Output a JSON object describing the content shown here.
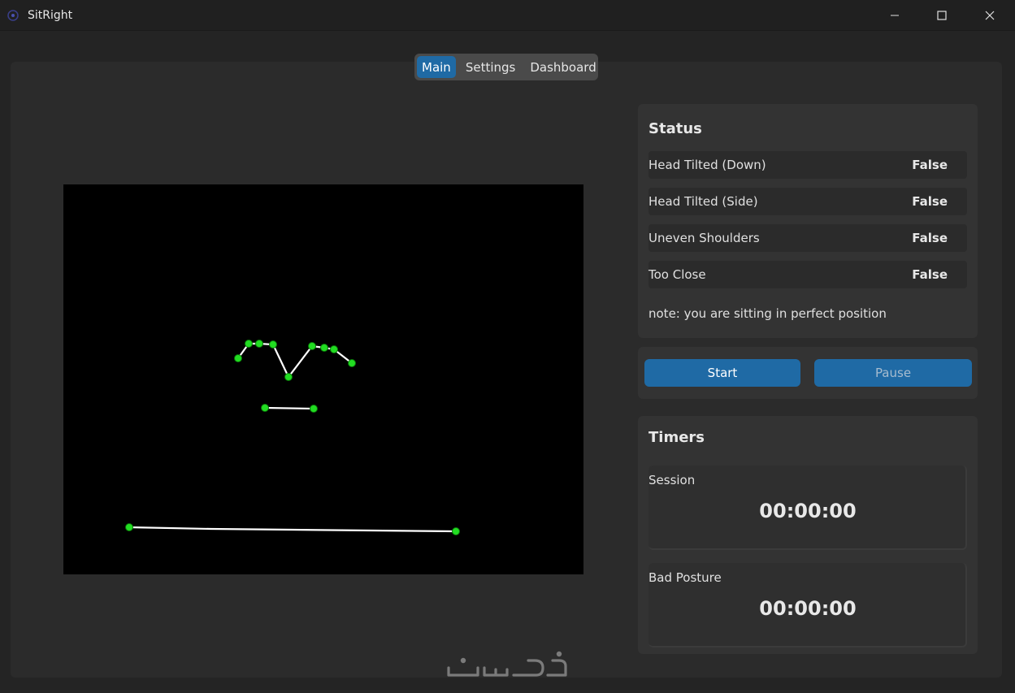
{
  "window": {
    "title": "SitRight",
    "app_icon": "sitright-logo-icon",
    "controls": [
      "minimize-icon",
      "maximize-icon",
      "close-icon"
    ]
  },
  "tabs": [
    {
      "label": "Main",
      "active": true
    },
    {
      "label": "Settings",
      "active": false
    },
    {
      "label": "Dashboard",
      "active": false
    }
  ],
  "status": {
    "heading": "Status",
    "rows": [
      {
        "label": "Head Tilted (Down)",
        "value": "False"
      },
      {
        "label": "Head Tilted (Side)",
        "value": "False"
      },
      {
        "label": "Uneven Shoulders",
        "value": "False"
      },
      {
        "label": "Too Close",
        "value": "False"
      }
    ],
    "note": "note: you are sitting in perfect position"
  },
  "controls": {
    "start_label": "Start",
    "pause_label": "Pause",
    "pause_enabled": false
  },
  "timers": {
    "heading": "Timers",
    "items": [
      {
        "label": "Session",
        "value": "00:00:00"
      },
      {
        "label": "Bad Posture",
        "value": "00:00:00"
      }
    ]
  },
  "colors": {
    "accent": "#1f6aa5",
    "landmark": "#22dd22",
    "skeleton_line": "#ffffff",
    "camera_bg": "#000000"
  },
  "watermark": {
    "text": "خمسات"
  }
}
